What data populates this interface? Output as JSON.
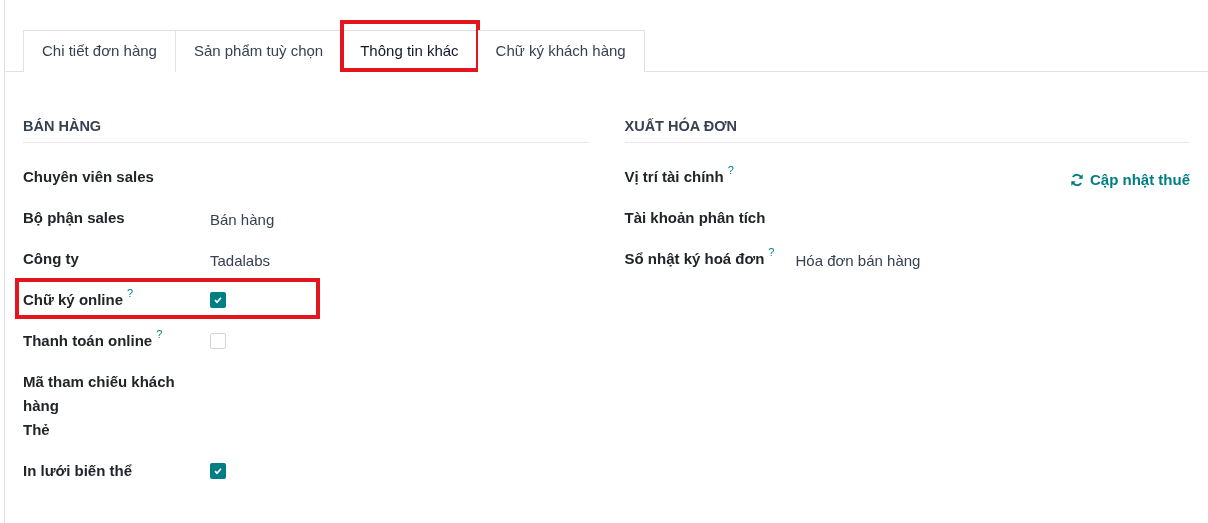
{
  "tabs": [
    {
      "label": "Chi tiết đơn hàng",
      "selected": false,
      "highlighted": false
    },
    {
      "label": "Sản phẩm tuỳ chọn",
      "selected": false,
      "highlighted": false
    },
    {
      "label": "Thông tin khác",
      "selected": true,
      "highlighted": true
    },
    {
      "label": "Chữ ký khách hàng",
      "selected": false,
      "highlighted": false
    }
  ],
  "sections": [
    {
      "title": "BÁN HÀNG",
      "fields": [
        {
          "kind": "text",
          "label": "Chuyên viên sales",
          "highlighted": false
        },
        {
          "kind": "text",
          "label": "Bộ phận sales",
          "value": "Bán hàng",
          "highlighted": false
        },
        {
          "kind": "text",
          "label": "Công ty",
          "value": "Tadalabs",
          "highlighted": false
        },
        {
          "kind": "checkbox",
          "label": "Chữ ký online",
          "help": "?",
          "checked": true,
          "highlighted": true
        },
        {
          "kind": "checkbox",
          "label": "Thanh toán online",
          "help": "?",
          "checked": false,
          "highlighted": false
        },
        {
          "kind": "text",
          "label": "Mã tham chiếu khách hàng",
          "highlighted": false
        },
        {
          "kind": "text",
          "label": "Thẻ",
          "highlighted": false
        },
        {
          "kind": "checkbox",
          "label": "In lưới biến thể",
          "checked": true,
          "highlighted": false
        }
      ]
    },
    {
      "title": "XUẤT HÓA ĐƠN",
      "fields": [
        {
          "kind": "text",
          "label": "Vị trí tài chính",
          "help": "?",
          "action": "Cập nhật thuế",
          "highlighted": false
        },
        {
          "kind": "text",
          "label": "Tài khoản phân tích",
          "highlighted": false
        },
        {
          "kind": "text",
          "label": "Sổ nhật ký hoá đơn",
          "value": "Hóa đơn bán hàng",
          "help": "?",
          "highlighted": false
        }
      ]
    }
  ]
}
